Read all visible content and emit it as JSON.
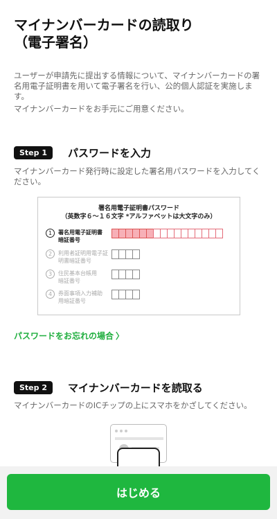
{
  "header": {
    "title_line1": "マイナンバーカードの読取り",
    "title_line2": "（電子署名）"
  },
  "intro": {
    "paragraph1": "ユーザーが申請先に提出する情報について、マイナンバーカードの署名用電子証明書を用いて電子署名を行い、公的個人認証を実施します。",
    "paragraph2": "マイナンバーカードをお手元にご用意ください。"
  },
  "step1": {
    "badge": "Step 1",
    "title": "パスワードを入力",
    "description": "マイナンバーカード発行時に設定した署名用パスワードを入力してください。"
  },
  "card_illustration": {
    "heading_line1": "署名用電子証明書パスワード",
    "heading_line2": "（英数字６～１６文字 *アルファベットは大文字のみ）",
    "rows": [
      {
        "number": "1",
        "label_line1": "署名用電子証明書",
        "label_line2": "暗証番号",
        "highlighted": true,
        "filled_boxes": 6,
        "outline_boxes": 10
      },
      {
        "number": "2",
        "label_line1": "利用者証明用電子証",
        "label_line2": "明書暗証番号",
        "highlighted": false,
        "boxes": 4
      },
      {
        "number": "3",
        "label_line1": "住民基本台帳用",
        "label_line2": "暗証番号",
        "highlighted": false,
        "boxes": 4
      },
      {
        "number": "4",
        "label_line1": "券面事項入力補助",
        "label_line2": "用暗証番号",
        "highlighted": false,
        "boxes": 4
      }
    ]
  },
  "forgot_link": {
    "label": "パスワードをお忘れの場合",
    "chevron": "〉",
    "color": "#1fae3e"
  },
  "step2": {
    "badge": "Step 2",
    "title": "マイナンバーカードを読取る",
    "description": "マイナンバーカードのICチップの上にスマホをかざしてください。"
  },
  "footer": {
    "start_button_label": "はじめる",
    "button_color": "#1fb73f"
  }
}
